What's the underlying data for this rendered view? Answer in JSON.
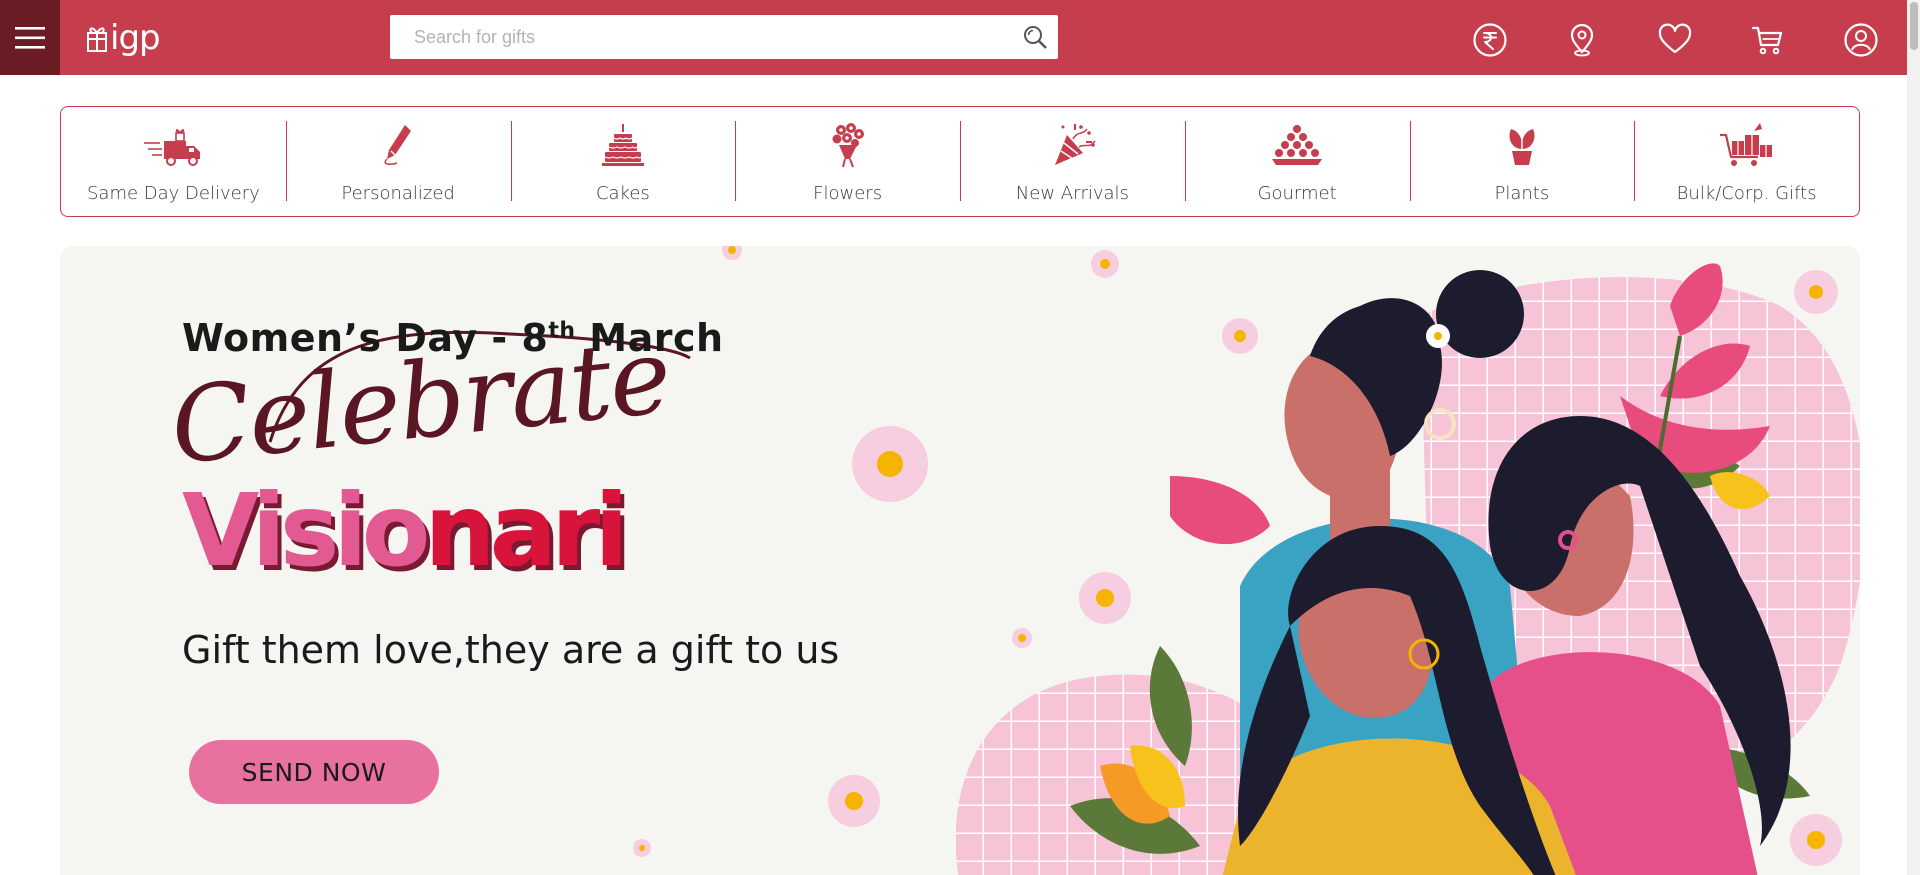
{
  "header": {
    "logo": "igp",
    "search_placeholder": "Search for gifts",
    "icons": [
      "currency-rupee-icon",
      "location-icon",
      "heart-icon",
      "cart-icon",
      "account-icon"
    ]
  },
  "categories": [
    {
      "label": "Same Day Delivery",
      "icon": "delivery-truck-icon"
    },
    {
      "label": "Personalized",
      "icon": "pen-icon"
    },
    {
      "label": "Cakes",
      "icon": "cake-icon"
    },
    {
      "label": "Flowers",
      "icon": "bouquet-icon"
    },
    {
      "label": "New Arrivals",
      "icon": "party-popper-icon"
    },
    {
      "label": "Gourmet",
      "icon": "sweets-icon"
    },
    {
      "label": "Plants",
      "icon": "plant-icon"
    },
    {
      "label": "Bulk/Corp. Gifts",
      "icon": "gift-cart-icon"
    }
  ],
  "banner": {
    "title_main": "Women’s Day - 8",
    "title_sup": "th",
    "title_end": " March",
    "script_text": "Celebrate",
    "brand_part1": "Visio",
    "brand_part2": "nari",
    "subtitle": "Gift them love,they are a gift to us",
    "cta": "SEND NOW"
  },
  "colors": {
    "header_bg": "#c63e4e",
    "menu_bg": "#6b1b24",
    "accent": "#c63e4e",
    "cta_bg": "#e8719f",
    "banner_bg": "#f5f5f1"
  }
}
